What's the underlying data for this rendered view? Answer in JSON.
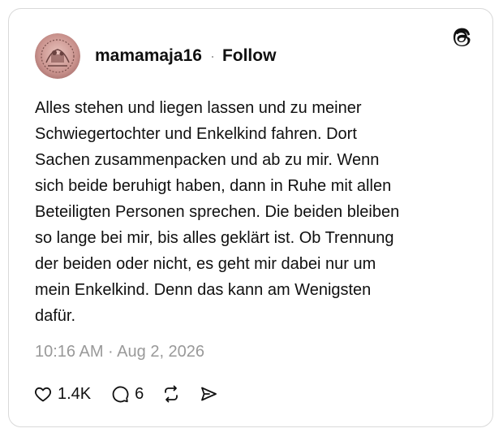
{
  "post": {
    "username": "mamamaja16",
    "separator": "·",
    "follow_label": "Follow",
    "text_lines": [
      "Alles stehen und liegen lassen und zu meiner",
      "Schwiegertochter und Enkelkind fahren. Dort",
      "Sachen zusammenpacken und ab zu mir. Wenn",
      "sich beide beruhigt haben, dann in Ruhe mit allen",
      "Beteiligten Personen sprechen. Die beiden bleiben",
      "so lange bei mir, bis alles geklärt ist. Ob Trennung",
      "der beiden oder nicht, es geht mir dabei nur um",
      "mein Enkelkind. Denn das kann am Wenigsten",
      "dafür."
    ],
    "timestamp": "10:16 AM · Aug 2, 2026"
  },
  "actions": {
    "like_count": "1.4K",
    "reply_count": "6"
  },
  "icons": {
    "brand": "threads-logo-icon",
    "avatar": "avatar-image",
    "like": "heart-icon",
    "reply": "comment-bubble-icon",
    "repost": "repost-icon",
    "share": "send-icon"
  },
  "colors": {
    "text": "#101010",
    "muted": "#999999",
    "border": "#d9d9d9",
    "avatar_tint": "#c9928d"
  }
}
